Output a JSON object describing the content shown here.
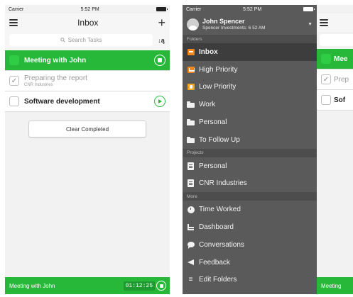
{
  "left_screen": {
    "status": {
      "carrier": "Carrier",
      "time": "5:52 PM"
    },
    "nav": {
      "title": "Inbox",
      "menu_icon": "hamburger-icon",
      "add_icon": "plus-icon"
    },
    "search": {
      "placeholder": "Search Tasks",
      "icon": "search-icon",
      "sort_icon": "sort-az-icon",
      "sort_label": "↓ą"
    },
    "tasks": [
      {
        "title": "Meeting with John",
        "subtitle": "",
        "state": "running"
      },
      {
        "title": "Preparing the report",
        "subtitle": "CNR Industries",
        "state": "completed"
      },
      {
        "title": "Software development",
        "subtitle": "",
        "state": "idle"
      }
    ],
    "clear_completed_label": "Clear Completed",
    "bottom_bar": {
      "task": "Meeting with John",
      "timer": "01:12:25"
    },
    "colors": {
      "accent_green": "#27b83a"
    }
  },
  "right_screen": {
    "status": {
      "carrier": "Carrier",
      "time": "5:52 PM"
    },
    "account": {
      "name": "John Spencer",
      "subtitle": "Spencer Investments: 6 52 AM",
      "caret": "▼"
    },
    "sections": {
      "folders": "Folders",
      "projects": "Projects",
      "more": "More"
    },
    "folders": [
      {
        "label": "Inbox",
        "icon": "inbox-icon",
        "selected": true
      },
      {
        "label": "High Priority",
        "icon": "high-priority-icon",
        "selected": false
      },
      {
        "label": "Low Priority",
        "icon": "low-priority-icon",
        "selected": false
      },
      {
        "label": "Work",
        "icon": "folder-icon",
        "selected": false
      },
      {
        "label": "Personal",
        "icon": "folder-icon",
        "selected": false
      },
      {
        "label": "To Follow Up",
        "icon": "folder-icon",
        "selected": false
      }
    ],
    "projects": [
      {
        "label": "Personal",
        "icon": "project-icon"
      },
      {
        "label": "CNR Industries",
        "icon": "project-icon"
      }
    ],
    "more": [
      {
        "label": "Time Worked",
        "icon": "clock-icon"
      },
      {
        "label": "Dashboard",
        "icon": "dashboard-icon"
      },
      {
        "label": "Conversations",
        "icon": "chat-icon"
      },
      {
        "label": "Feedback",
        "icon": "megaphone-icon"
      },
      {
        "label": "Edit Folders",
        "icon": "edit-icon"
      }
    ],
    "peek": {
      "rows": [
        "Mee",
        "Prep",
        "Sof"
      ],
      "row_sub": "CNR",
      "bottom": "Meeting"
    }
  }
}
